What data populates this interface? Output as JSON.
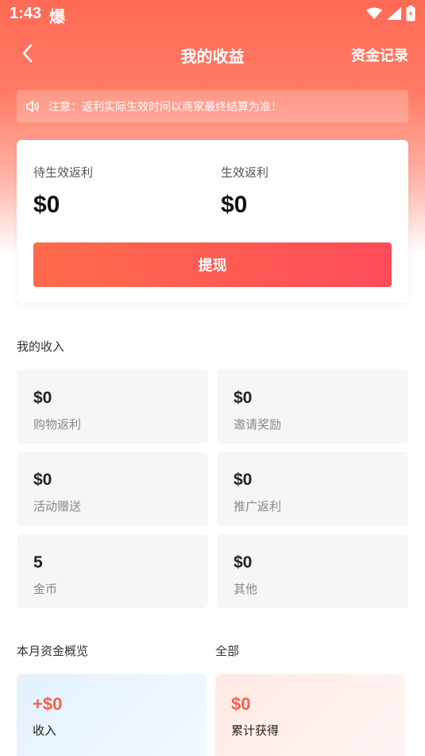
{
  "status_bar": {
    "time": "1:43",
    "glyph": "爆"
  },
  "nav": {
    "title": "我的收益",
    "right_action": "资金记录"
  },
  "notice": {
    "text": "注意：返利实际生效时间以商家最终结算为准！"
  },
  "summary": {
    "pending": {
      "label": "待生效返利",
      "value": "$0"
    },
    "effective": {
      "label": "生效返利",
      "value": "$0"
    },
    "withdraw_label": "提现"
  },
  "income": {
    "title": "我的收入",
    "tiles": [
      {
        "value": "$0",
        "label": "购物返利"
      },
      {
        "value": "$0",
        "label": "邀请奖励"
      },
      {
        "value": "$0",
        "label": "活动赠送"
      },
      {
        "value": "$0",
        "label": "推广返利"
      },
      {
        "value": "5",
        "label": "金币"
      },
      {
        "value": "$0",
        "label": "其他"
      }
    ]
  },
  "overview": {
    "title": "本月资金概览",
    "filter": "全部",
    "cards": [
      {
        "value": "+$0",
        "label": "收入"
      },
      {
        "value": "$0",
        "label": "累计获得"
      }
    ]
  },
  "colors": {
    "accent": "#ff6a55",
    "button_start": "#ff6b4c",
    "button_end": "#ff4c59",
    "overview_value": "#f0644e"
  }
}
